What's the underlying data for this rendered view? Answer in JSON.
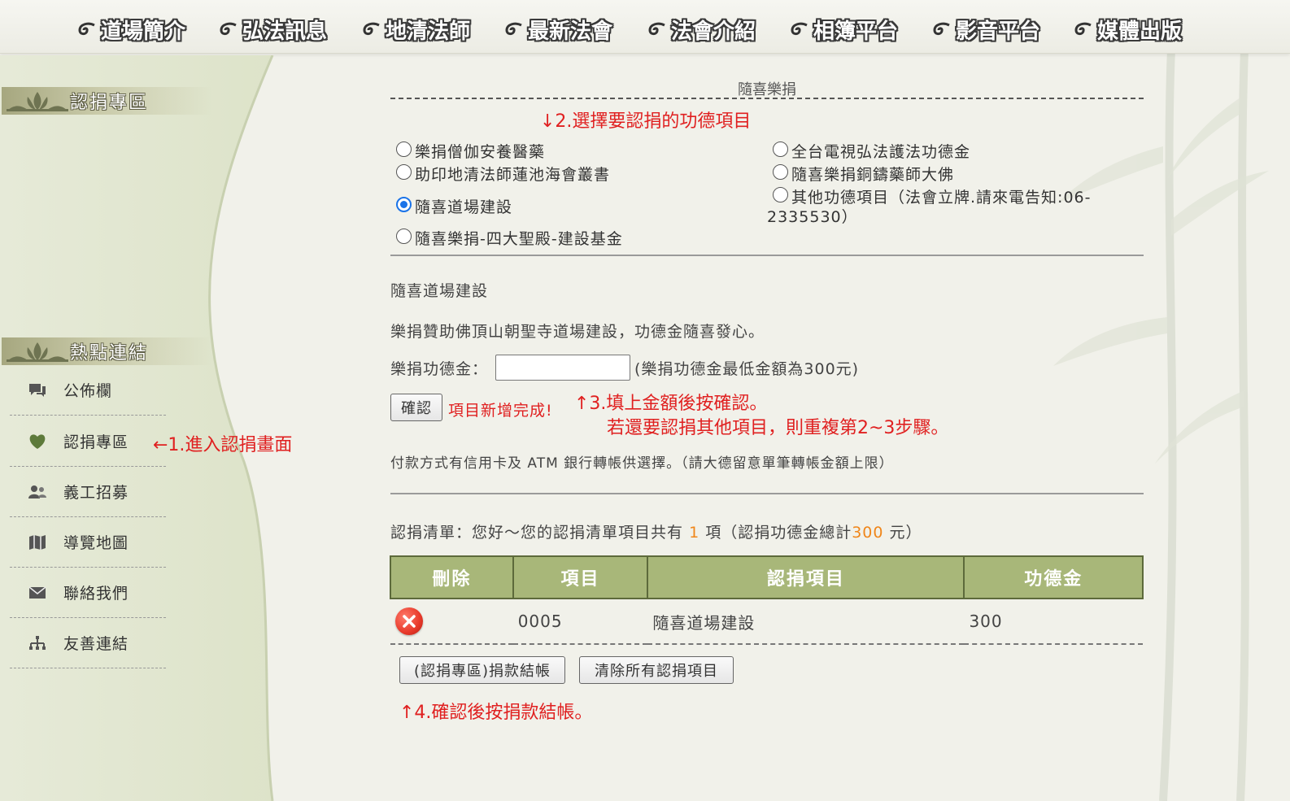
{
  "nav": {
    "items": [
      "道場簡介",
      "弘法訊息",
      "地清法師",
      "最新法會",
      "法會介紹",
      "相簿平台",
      "影音平台",
      "媒體出版"
    ]
  },
  "sidebar": {
    "section1_title": "認捐專區",
    "section2_title": "熱點連結",
    "links": [
      {
        "label": "公佈欄",
        "icon": "chat-icon"
      },
      {
        "label": "認捐專區",
        "icon": "heart-icon"
      },
      {
        "label": "義工招募",
        "icon": "people-icon"
      },
      {
        "label": "導覽地圖",
        "icon": "map-icon"
      },
      {
        "label": "聯絡我們",
        "icon": "mail-icon"
      },
      {
        "label": "友善連結",
        "icon": "sitemap-icon"
      }
    ]
  },
  "annotations": {
    "step1": "←1.進入認捐畫面",
    "step2": "↓2.選擇要認捐的功德項目",
    "step3_line1": "↑3.填上金額後按確認。",
    "step3_line2": "若還要認捐其他項目，則重複第2~3步驟。",
    "step4": "↑4.確認後按捐款結帳。"
  },
  "form": {
    "title": "隨喜樂捐",
    "options": [
      {
        "label": "樂捐僧伽安養醫藥",
        "checked": false
      },
      {
        "label": "助印地清法師蓮池海會叢書",
        "checked": false
      },
      {
        "label": "隨喜道場建設",
        "checked": true
      },
      {
        "label": "隨喜樂捐-四大聖殿-建設基金",
        "checked": false
      },
      {
        "label": "全台電視弘法護法功德金",
        "checked": false
      },
      {
        "label": "隨喜樂捐銅鑄藥師大佛",
        "checked": false
      },
      {
        "label": "其他功德項目（法會立牌.請來電告知:06-",
        "checked": false
      }
    ],
    "other_line2": "2335530）",
    "selected_title": "隨喜道場建設",
    "selected_desc": "樂捐贊助佛頂山朝聖寺道場建設，功德金隨喜發心。",
    "amount_label": "樂捐功德金：",
    "amount_value": "",
    "amount_note": "(樂捐功德金最低金額為300元)",
    "confirm_label": "確認",
    "success_msg": "項目新增完成!",
    "payment_note": "付款方式有信用卡及 ATM 銀行轉帳供選擇。（請大德留意單筆轉帳金額上限）"
  },
  "cart": {
    "summary_prefix": "認捐清單：您好～您的認捐清單項目共有",
    "count": "1",
    "summary_mid": "項（認捐功德金總計",
    "total": "300",
    "summary_suffix": "元）",
    "headers": [
      "刪除",
      "項目",
      "認捐項目",
      "功德金"
    ],
    "rows": [
      {
        "code": "0005",
        "name": "隨喜道場建設",
        "amount": "300"
      }
    ],
    "checkout_label": "(認捐專區)捐款結帳",
    "clear_label": "清除所有認捐項目"
  },
  "colors": {
    "table_header": "#a8b779",
    "annotation": "#e02020",
    "highlight": "#f0861a"
  }
}
